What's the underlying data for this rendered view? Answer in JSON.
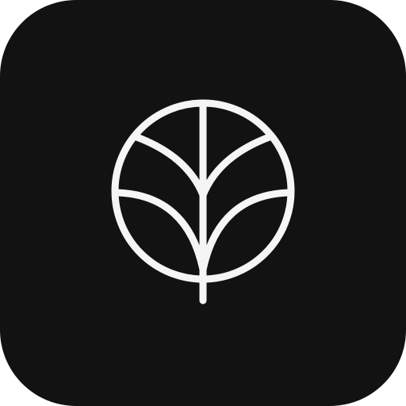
{
  "app_icon": {
    "icon": "leaf-in-circle-icon",
    "background_color": "#121212",
    "stroke_color": "#f5f5f5"
  }
}
